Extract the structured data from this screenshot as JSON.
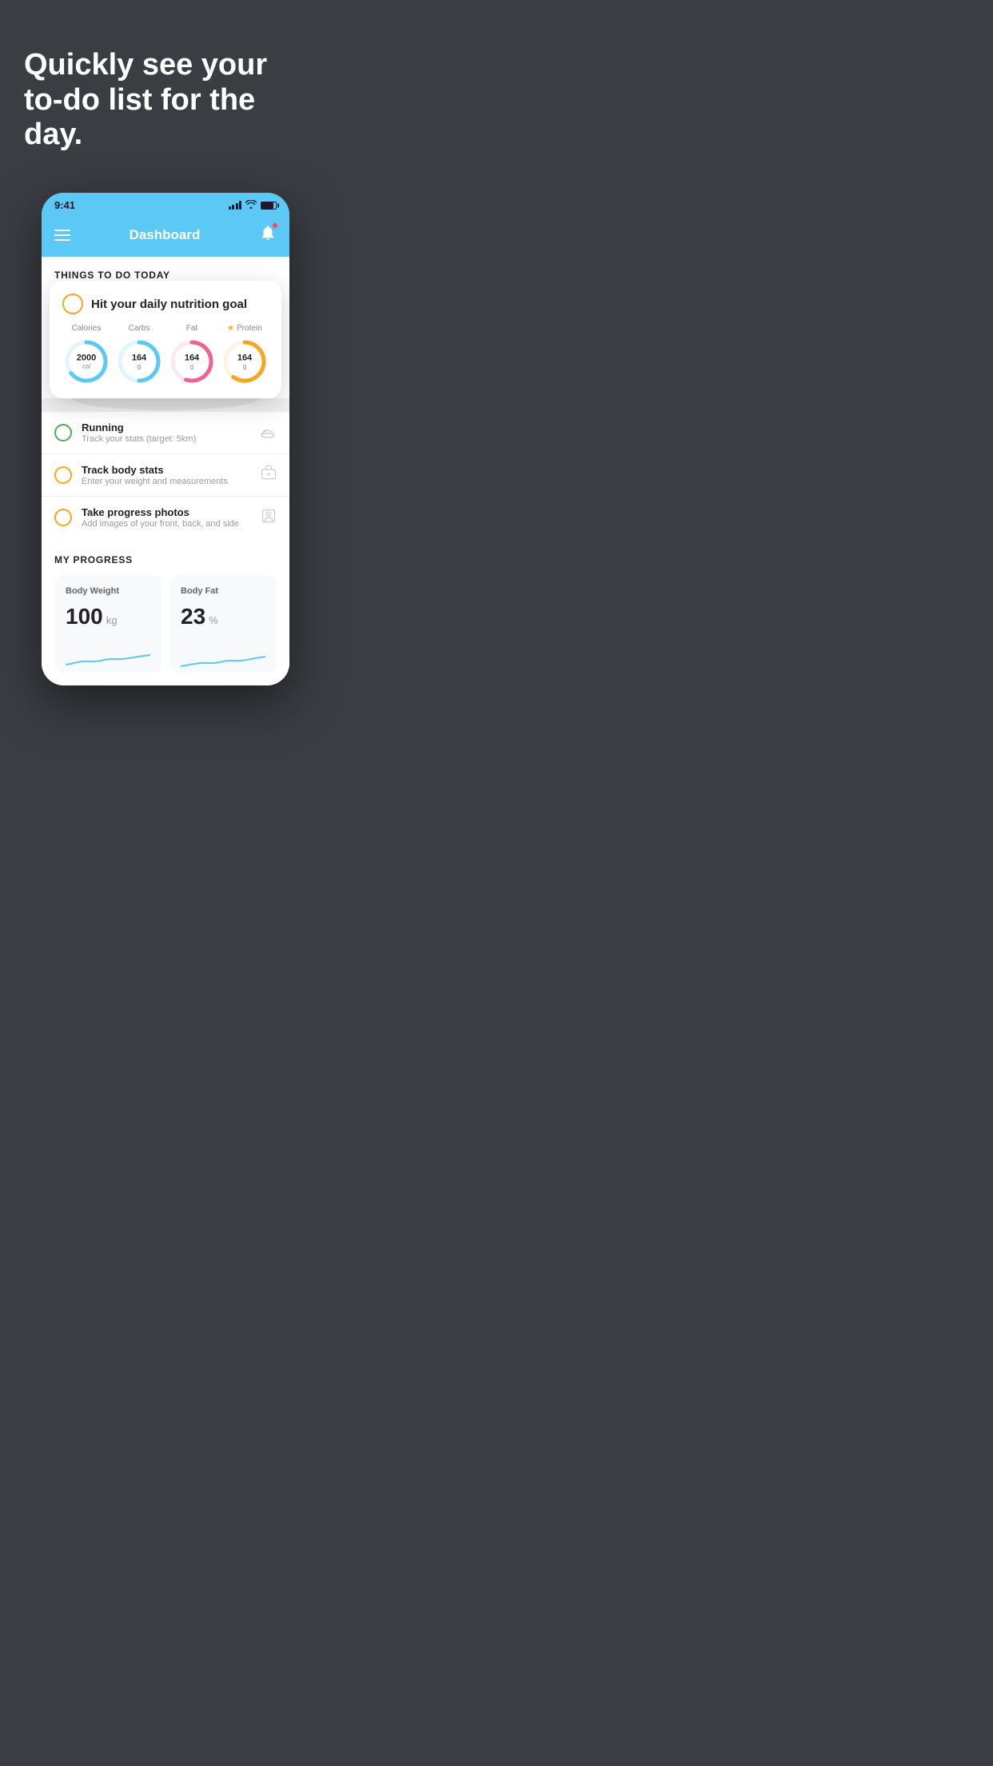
{
  "hero": {
    "title": "Quickly see your to-do list for the day."
  },
  "phone": {
    "statusBar": {
      "time": "9:41"
    },
    "header": {
      "title": "Dashboard"
    },
    "sectionHeading": "THINGS TO DO TODAY",
    "floatingCard": {
      "title": "Hit your daily nutrition goal",
      "nutrition": [
        {
          "label": "Calories",
          "value": "2000",
          "unit": "cal",
          "color": "#5bc8f5",
          "trackColor": "#e0f5fd",
          "percent": 65
        },
        {
          "label": "Carbs",
          "value": "164",
          "unit": "g",
          "color": "#5bc8f5",
          "trackColor": "#e0f5fd",
          "percent": 50
        },
        {
          "label": "Fat",
          "value": "164",
          "unit": "g",
          "color": "#f06292",
          "trackColor": "#fde8ef",
          "percent": 55
        },
        {
          "label": "Protein",
          "value": "164",
          "unit": "g",
          "color": "#f5a623",
          "trackColor": "#fef3de",
          "percent": 60,
          "hasStar": true
        }
      ]
    },
    "todoItems": [
      {
        "id": "running",
        "title": "Running",
        "subtitle": "Track your stats (target: 5km)",
        "circleColor": "green",
        "icon": "shoe"
      },
      {
        "id": "track-body-stats",
        "title": "Track body stats",
        "subtitle": "Enter your weight and measurements",
        "circleColor": "yellow",
        "icon": "scale"
      },
      {
        "id": "progress-photos",
        "title": "Take progress photos",
        "subtitle": "Add images of your front, back, and side",
        "circleColor": "yellow",
        "icon": "person"
      }
    ],
    "progressSection": {
      "title": "MY PROGRESS",
      "cards": [
        {
          "title": "Body Weight",
          "value": "100",
          "unit": "kg"
        },
        {
          "title": "Body Fat",
          "value": "23",
          "unit": "%"
        }
      ]
    }
  }
}
